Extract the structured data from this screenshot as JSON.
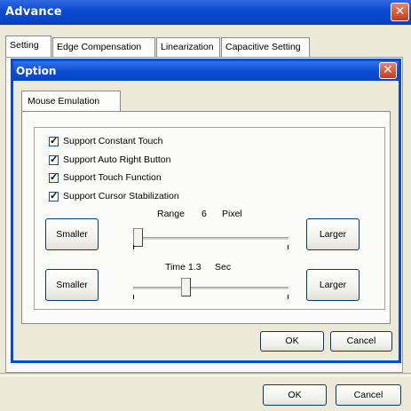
{
  "window": {
    "title": "Advance",
    "close_glyph": "✕",
    "tabs": [
      {
        "label": "Setting"
      },
      {
        "label": "Edge Compensation"
      },
      {
        "label": "Linearization"
      },
      {
        "label": "Capacitive Setting"
      }
    ],
    "ok_label": "OK",
    "cancel_label": "Cancel"
  },
  "dialog": {
    "title": "Option",
    "close_glyph": "✕",
    "tab_label": "Mouse Emulation",
    "checkboxes": [
      {
        "label": "Support Constant Touch",
        "checked": true
      },
      {
        "label": "Support Auto Right Button",
        "checked": true
      },
      {
        "label": "Support Touch Function",
        "checked": true
      },
      {
        "label": "Support Cursor Stabilization",
        "checked": true
      }
    ],
    "check_glyph": "✓",
    "range": {
      "label": "Range",
      "value": "6",
      "unit": "Pixel",
      "smaller_label": "Smaller",
      "larger_label": "Larger",
      "level": 0.0
    },
    "time": {
      "label": "Time",
      "value": "1.3",
      "unit": "Sec",
      "smaller_label": "Smaller",
      "larger_label": "Larger",
      "level": 0.33
    },
    "ok_label": "OK",
    "cancel_label": "Cancel"
  },
  "colors": {
    "title_blue": "#0a4ad0",
    "close_red": "#c63b1a",
    "face": "#ece9d8"
  }
}
